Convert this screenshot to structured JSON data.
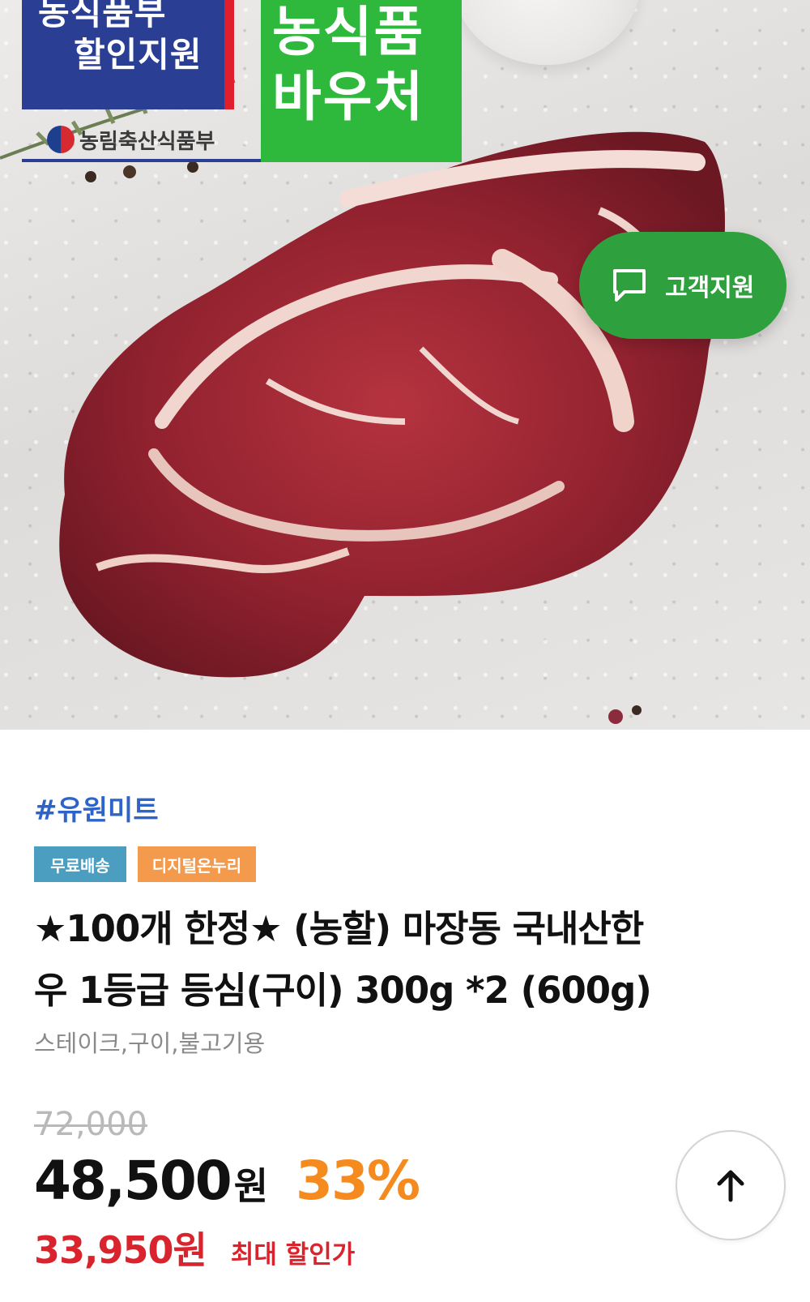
{
  "hero": {
    "gov_badge_line1": "농식품부",
    "gov_badge_line2": "할인지원",
    "voucher_line1": "농식품",
    "voucher_line2": "바우처",
    "ministry_name": "농림축산식품부"
  },
  "support": {
    "label": "고객지원",
    "icon": "chat-bubble-icon"
  },
  "product": {
    "store_tag": "#유원미트",
    "chips": [
      "무료배송",
      "디지털온누리"
    ],
    "title_line1": "★100개 한정★ (농할) 마장동 국내산한",
    "title_line2": "우 1등급 등심(구이) 300g *2 (600g)",
    "subtitle": "스테이크,구이,불고기용",
    "original_price": "72,000",
    "price": "48,500",
    "price_unit": "원",
    "discount": "33%",
    "max_discount_price": "33,950원",
    "max_discount_label": "최대 할인가"
  },
  "scroll_top": {
    "icon": "arrow-up-icon"
  },
  "colors": {
    "store_tag": "#2e63c7",
    "chip_free_shipping": "#4b9ec0",
    "chip_onnuri": "#f39a4d",
    "discount": "#f58a1e",
    "max_price": "#d9232d",
    "support_pill": "#2ea03d",
    "voucher_green": "#2fb93c",
    "gov_blue": "#2a3f94"
  }
}
